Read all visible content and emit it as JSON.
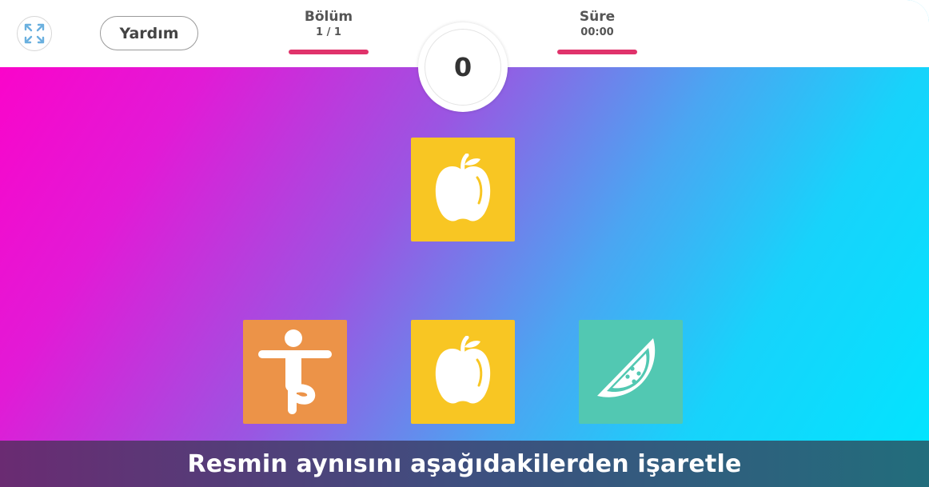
{
  "header": {
    "help_label": "Yardım",
    "level_label": "Bölüm",
    "level_value": "1 / 1",
    "time_label": "Süre",
    "time_value": "00:00",
    "score": "0"
  },
  "board": {
    "target": {
      "icon": "apple-icon",
      "color": "#f8c623"
    },
    "options": [
      {
        "icon": "person-balance-icon",
        "color": "#ec9348"
      },
      {
        "icon": "apple-icon",
        "color": "#f8c623"
      },
      {
        "icon": "watermelon-slice-icon",
        "color": "#52c8b2"
      }
    ]
  },
  "instruction": "Resmin aynısını aşağıdakilerden işaretle",
  "colors": {
    "accent_bar": "#e0336b",
    "fullscreen_icon": "#6ab0df"
  }
}
